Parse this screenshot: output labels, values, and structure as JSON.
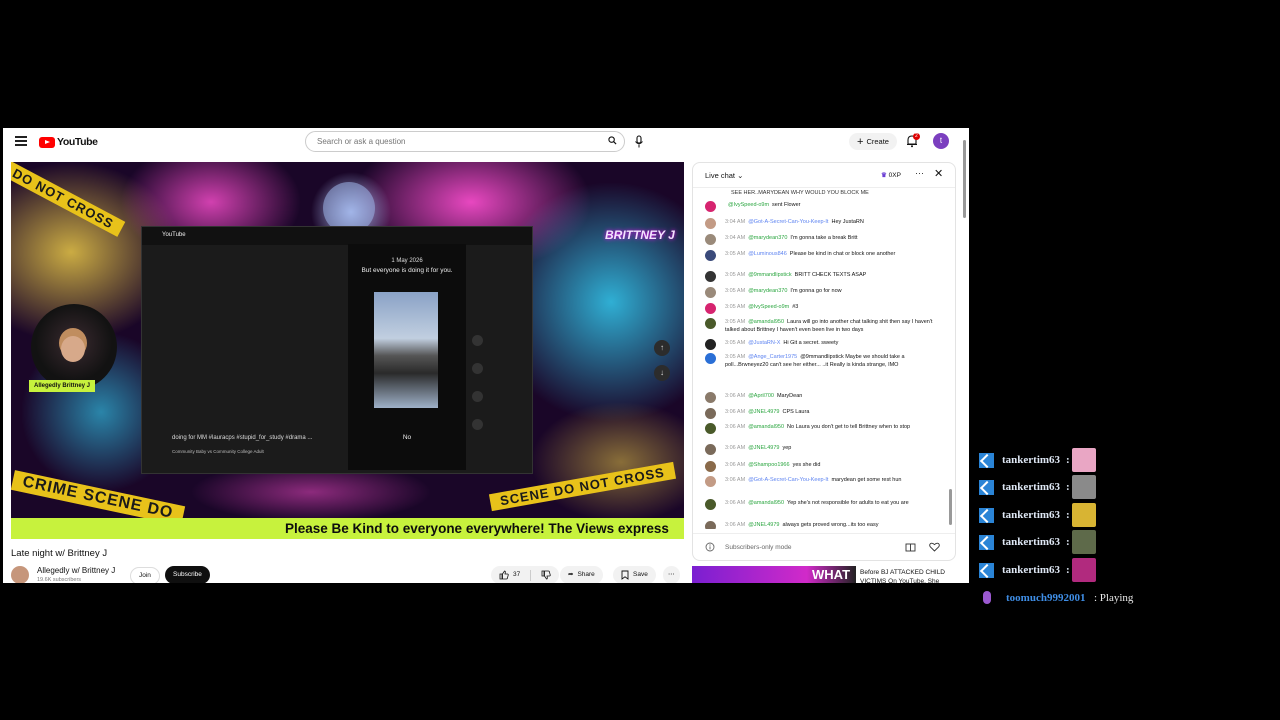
{
  "masthead": {
    "logo_text": "YouTube",
    "search_placeholder": "Search or ask a question",
    "create_label": "Create",
    "notif_count": "2",
    "avatar_letter": "t"
  },
  "player": {
    "streamer_tag": "Allegedly Brittney J",
    "brand_text": "BRITTNEY J",
    "tape_top": "DO NOT CROSS",
    "tape_bottom_left": "CRIME SCENE DO",
    "tape_bottom_right": "SCENE DO NOT CROSS",
    "ticker": "Please Be Kind to everyone everywhere! The Views express",
    "inner": {
      "logo": "YouTube",
      "date": "1 May 2026",
      "message": "But everyone is doing it for you.",
      "answer": "No",
      "caption": "doing for MM  #lauracps #stupid_for_study #drama ...",
      "subcaption": "Community Baby vs Community College Adult"
    }
  },
  "video": {
    "title": "Late night w/ Brittney J",
    "channel": "Allegedly w/ Brittney J",
    "subs": "19.6K subscribers",
    "join": "Join",
    "subscribe": "Subscribe",
    "likes": "37",
    "share": "Share",
    "save": "Save"
  },
  "chat": {
    "title": "Live chat",
    "xp": "0XP",
    "footer": "Subscribers-only mode",
    "messages": [
      {
        "time": "",
        "author": "",
        "text": "SEE HER..MARYDEAN WHY WOULD YOU BLOCK ME",
        "color": "#999999"
      },
      {
        "time": "",
        "author": "@IvySpeed-o9m",
        "text": "sent Flower",
        "color": "#d6246f"
      },
      {
        "time": "3:04 AM",
        "author": "@Got-A-Secret-Can-You-Keep-It",
        "text": "Hey JustaRN",
        "color": "#c39b85"
      },
      {
        "time": "3:04 AM",
        "author": "@marydean370",
        "text": "I'm gonna take a break Britt",
        "color": "#9a8a7a"
      },
      {
        "time": "3:05 AM",
        "author": "@Luminous846",
        "text": "Please be kind in chat or block one another",
        "color": "#3a4a7a"
      },
      {
        "time": "3:05 AM",
        "author": "@9mmandlipstick",
        "text": "BRITT CHECK TEXTS ASAP",
        "color": "#333333"
      },
      {
        "time": "3:05 AM",
        "author": "@marydean370",
        "text": "I'm gonna go for now",
        "color": "#9a8a7a"
      },
      {
        "time": "3:05 AM",
        "author": "@IvySpeed-o9m",
        "text": "#3",
        "color": "#d6246f"
      },
      {
        "time": "3:05 AM",
        "author": "@amandal950",
        "text": "Laura will go into another chat talking shit then say I haven't talked about Brittney I haven't even been live in two days",
        "color": "#4a5a2a"
      },
      {
        "time": "3:05 AM",
        "author": "@JustaRN-X",
        "text": "Hi Git a secret.  sweety",
        "color": "#222222"
      },
      {
        "time": "3:05 AM",
        "author": "@Ange_Carter1975",
        "text": "@9mmandlipstick Maybe we should take a poll...Brwneyez20 can't see her either...  ..it Really is kinda strange, IMO",
        "color": "#2a6fd6"
      },
      {
        "time": "3:06 AM",
        "author": "@April700",
        "text": "MaryDean",
        "color": "#8a7a6a"
      },
      {
        "time": "3:06 AM",
        "author": "@JNEL4979",
        "text": "CPS Laura",
        "color": "#7a6a5a"
      },
      {
        "time": "3:06 AM",
        "author": "@amandal950",
        "text": "No Laura you don't get to tell Brittney when to stop",
        "color": "#4a5a2a"
      },
      {
        "time": "3:06 AM",
        "author": "@JNEL4979",
        "text": "yep",
        "color": "#7a6a5a"
      },
      {
        "time": "3:06 AM",
        "author": "@Shampoo1966",
        "text": "yes she did",
        "color": "#8a6a4a"
      },
      {
        "time": "3:06 AM",
        "author": "@Got-A-Secret-Can-You-Keep-It",
        "text": "marydean get some rest hun",
        "color": "#c39b85"
      },
      {
        "time": "3:06 AM",
        "author": "@amandal950",
        "text": "Yep she's not responsible for adults to eat you are",
        "color": "#4a5a2a"
      },
      {
        "time": "3:06 AM",
        "author": "@JNEL4979",
        "text": "always gets proved wrong...its too easy",
        "color": "#7a6a5a"
      }
    ]
  },
  "recommendation": {
    "thumb_text": "WHAT",
    "title": "Before BJ ATTACKED CHILD VICTIMS On YouTube, She"
  },
  "overlay": {
    "rows": [
      {
        "user": "tankertim63",
        "sep": ":",
        "emote": "#e9a6c4"
      },
      {
        "user": "tankertim63",
        "sep": ":",
        "emote": "#8a8a8a"
      },
      {
        "user": "tankertim63",
        "sep": ":",
        "emote": "#d8b433"
      },
      {
        "user": "tankertim63",
        "sep": ":",
        "emote": "#5e6a4a"
      },
      {
        "user": "tankertim63",
        "sep": ":",
        "emote": "#b12a7e"
      }
    ],
    "voice_user": "toomuch9992001",
    "voice_status": ": Playing"
  }
}
